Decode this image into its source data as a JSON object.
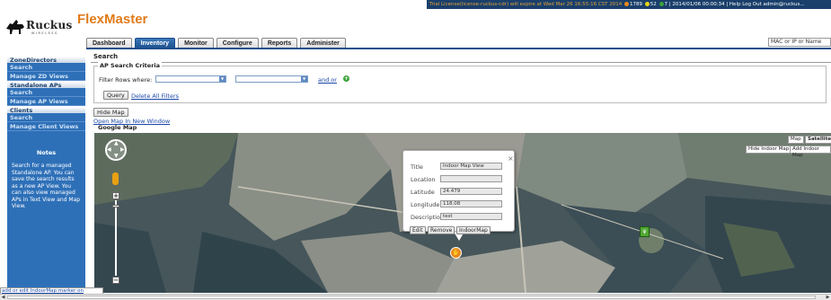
{
  "topbar": {
    "license": "Trial License(license-ruckus-cdr) will expire at Wed Mar 26 16:55:16 CST 2014",
    "count_orange": "1789",
    "count_yellow": "52",
    "count_green": "7",
    "datetime": "2014/01/06 00:00:34",
    "help": "Help",
    "logout": "Log Out",
    "user": "admin@ruckus...",
    "colors": {
      "bar": "#1a3f6b",
      "orange": "#e98a1c",
      "yellow": "#e8d21a",
      "green": "#3aa33a"
    }
  },
  "logo": {
    "text": "Ruckus",
    "sub": "WIRELESS"
  },
  "app_name": "FlexMaster",
  "nav": {
    "tabs": [
      "Dashboard",
      "Inventory",
      "Monitor",
      "Configure",
      "Reports",
      "Administer"
    ],
    "active": "Inventory"
  },
  "search": {
    "placeholder": "MAC or IP or Name"
  },
  "sidebar": {
    "sections": [
      {
        "title": "ZoneDirectors",
        "items": [
          "Search",
          "Manage ZD Views"
        ]
      },
      {
        "title": "Standalone APs",
        "items": [
          "Search",
          "Manage AP Views"
        ]
      },
      {
        "title": "Clients",
        "items": [
          "Search",
          "Manage Client Views"
        ]
      }
    ],
    "notes_title": "Notes",
    "notes": "Search for a managed Standalone AP. You can save the search results as a new AP View. You can also view managed APs in Text View and Map View."
  },
  "content": {
    "title": "Search",
    "criteria_legend": "AP Search Criteria",
    "filter_label": "Filter Rows where:",
    "and_or": "and  or",
    "query": "Query",
    "delete_filters": "Delete All Filters",
    "hide_map": "Hide Map",
    "open_new_window": "Open Map In New Window",
    "google_map": "Google Map"
  },
  "map": {
    "map_btn": "Map",
    "satellite_btn": "Satellite",
    "hide_indoor": "Hide Indoor Map",
    "add_indoor": "Add Indoor Map",
    "popup": {
      "title_label": "Title",
      "title_value": "Indoor Map View",
      "location_label": "Location",
      "location_value": "",
      "latitude_label": "Latitude",
      "latitude_value": "24.479",
      "longitude_label": "Longitude",
      "longitude_value": "118.08",
      "description_label": "Description",
      "description_value": "test",
      "edit": "Edit",
      "remove": "Remove",
      "indoormap": "IndoorMap",
      "close": "×"
    }
  },
  "status": "add or edit IndoorMap marker on"
}
